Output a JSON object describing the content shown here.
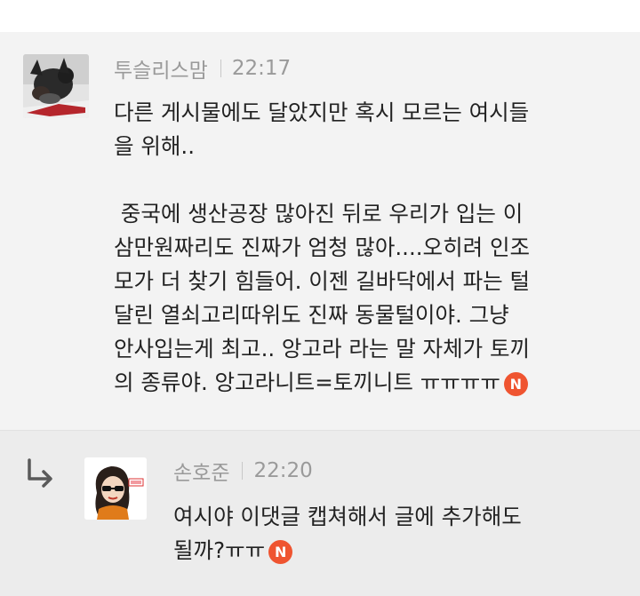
{
  "comments": [
    {
      "author": "투슬리스맘",
      "time": "22:17",
      "lines": [
        "다른 게시물에도 달았지만 혹시 모르는 여시들",
        "을 위해..",
        "",
        " 중국에 생산공장 많아진 뒤로 우리가 입는 이",
        "삼만원짜리도 진짜가 엄청 많아....오히려 인조",
        "모가 더 찾기 힘들어. 이젠 길바닥에서 파는 털",
        "달린 열쇠고리따위도 진짜 동물털이야. 그냥",
        "안사입는게 최고.. 앙고라 라는 말 자체가 토끼",
        "의 종류야. 앙고라니트=토끼니트 ㅠㅠㅠㅠ"
      ],
      "badge": "N"
    },
    {
      "author": "손호준",
      "time": "22:20",
      "lines": [
        "여시야 이댓글 캡쳐해서 글에 추가해도",
        "될까?ㅠㅠ"
      ],
      "badge": "N"
    }
  ],
  "icons": {
    "reply_arrow": "reply-arrow-icon",
    "new_badge": "new-badge-icon"
  },
  "colors": {
    "badge": "#ef5430",
    "meta_text": "#9a9a9a",
    "body_text": "#222222"
  }
}
